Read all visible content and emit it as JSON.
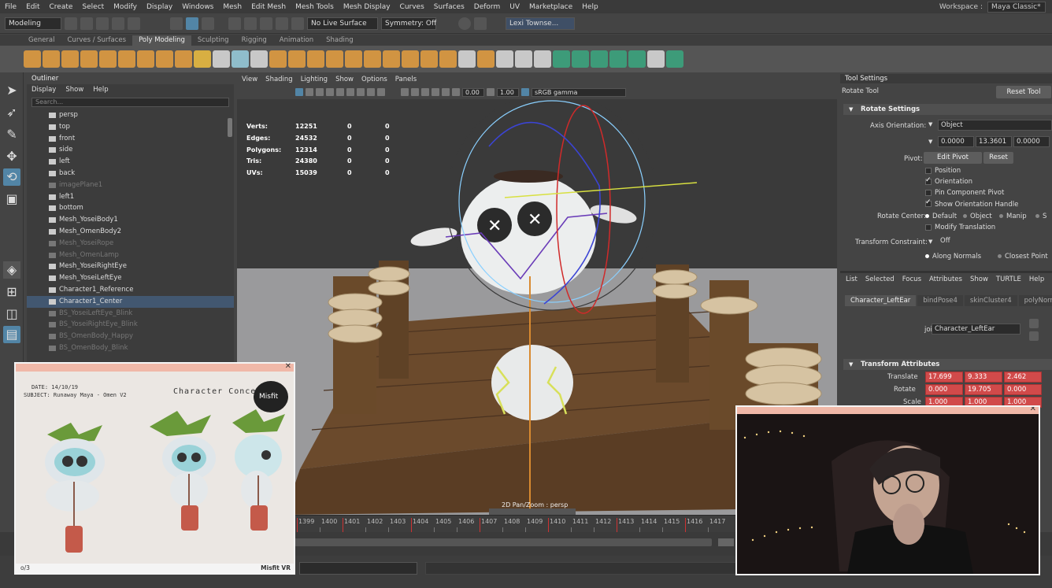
{
  "menubar": {
    "items": [
      "File",
      "Edit",
      "Create",
      "Select",
      "Modify",
      "Display",
      "Windows",
      "Mesh",
      "Edit Mesh",
      "Mesh Tools",
      "Mesh Display",
      "Curves",
      "Surfaces",
      "Deform",
      "UV",
      "Marketplace",
      "Help"
    ],
    "workspace_label": "Workspace :",
    "workspace_value": "Maya Classic*"
  },
  "status_line": {
    "mode": "Modeling",
    "live_surface": "No Live Surface",
    "symmetry": "Symmetry: Off",
    "user": "Lexi Townse..."
  },
  "shelf": {
    "tabs": [
      "General",
      "Curves / Surfaces",
      "Poly Modeling",
      "Sculpting",
      "Rigging",
      "Animation",
      "Shading"
    ],
    "active_tab": "Poly Modeling"
  },
  "outliner": {
    "title": "Outliner",
    "menu": [
      "Display",
      "Show",
      "Help"
    ],
    "search_placeholder": "Search...",
    "items": [
      {
        "label": "persp",
        "dim": false
      },
      {
        "label": "top",
        "dim": false
      },
      {
        "label": "front",
        "dim": false
      },
      {
        "label": "side",
        "dim": false
      },
      {
        "label": "left",
        "dim": false
      },
      {
        "label": "back",
        "dim": false
      },
      {
        "label": "imagePlane1",
        "dim": true
      },
      {
        "label": "left1",
        "dim": false
      },
      {
        "label": "bottom",
        "dim": false
      },
      {
        "label": "Mesh_YoseiBody1",
        "dim": false
      },
      {
        "label": "Mesh_OmenBody2",
        "dim": false
      },
      {
        "label": "Mesh_YoseiRope",
        "dim": true
      },
      {
        "label": "Mesh_OmenLamp",
        "dim": true
      },
      {
        "label": "Mesh_YoseiRightEye",
        "dim": false
      },
      {
        "label": "Mesh_YoseiLeftEye",
        "dim": false
      },
      {
        "label": "Character1_Reference",
        "dim": false
      },
      {
        "label": "Character1_Center",
        "dim": false,
        "selected": true
      },
      {
        "label": "BS_YoseiLeftEye_Blink",
        "dim": true
      },
      {
        "label": "BS_YoseiRightEye_Blink",
        "dim": true
      },
      {
        "label": "BS_OmenBody_Happy",
        "dim": true
      },
      {
        "label": "BS_OmenBody_Blink",
        "dim": true
      }
    ]
  },
  "viewport": {
    "menu": [
      "View",
      "Shading",
      "Lighting",
      "Show",
      "Options",
      "Panels"
    ],
    "exposure": "0.00",
    "gamma": "1.00",
    "color_space": "sRGB gamma",
    "hud": [
      {
        "label": "Verts:",
        "value": "12251",
        "a": "0",
        "b": "0"
      },
      {
        "label": "Edges:",
        "value": "24532",
        "a": "0",
        "b": "0"
      },
      {
        "label": "Polygons:",
        "value": "12314",
        "a": "0",
        "b": "0"
      },
      {
        "label": "Tris:",
        "value": "24380",
        "a": "0",
        "b": "0"
      },
      {
        "label": "UVs:",
        "value": "15039",
        "a": "0",
        "b": "0"
      }
    ],
    "camera_label": "2D Pan/Zoom : persp"
  },
  "tool_settings": {
    "title": "Tool Settings",
    "tool_name": "Rotate Tool",
    "reset_button": "Reset Tool",
    "section": "Rotate Settings",
    "axis_orientation_label": "Axis Orientation:",
    "axis_orientation_value": "Object",
    "axis_values": [
      "0.0000",
      "13.3601",
      "0.0000"
    ],
    "pivot_label": "Pivot:",
    "edit_pivot": "Edit Pivot",
    "reset": "Reset",
    "options": [
      {
        "label": "Position",
        "checked": false
      },
      {
        "label": "Orientation",
        "checked": true
      },
      {
        "label": "Pin Component Pivot",
        "checked": false
      },
      {
        "label": "Show Orientation Handle",
        "checked": true
      }
    ],
    "rotate_center_label": "Rotate Center:",
    "rotate_center_options": [
      {
        "label": "Default",
        "selected": true
      },
      {
        "label": "Object",
        "selected": false
      },
      {
        "label": "Manip",
        "selected": false
      },
      {
        "label": "S",
        "selected": false
      }
    ],
    "modify_translation": "Modify Translation",
    "transform_constraint_label": "Transform Constraint:",
    "transform_constraint_value": "Off",
    "along_normals": "Along Normals",
    "closest_point": "Closest Point"
  },
  "attribute_editor": {
    "menu": [
      "List",
      "Selected",
      "Focus",
      "Attributes",
      "Show",
      "TURTLE",
      "Help"
    ],
    "tabs": [
      "Character_LeftEar",
      "bindPose4",
      "skinCluster4",
      "polyNormal1"
    ],
    "joint_label": "joint:",
    "joint_value": "Character_LeftEar",
    "section": "Transform Attributes",
    "rows": [
      {
        "label": "Translate",
        "values": [
          "17.699",
          "9.333",
          "2.462"
        ]
      },
      {
        "label": "Rotate",
        "values": [
          "0.000",
          "19.705",
          "0.000"
        ]
      },
      {
        "label": "Scale",
        "values": [
          "1.000",
          "1.000",
          "1.000"
        ]
      }
    ]
  },
  "timeline": {
    "frames": [
      "1399",
      "1400",
      "1401",
      "1402",
      "1403",
      "1404",
      "1405",
      "1406",
      "1407",
      "1408",
      "1409",
      "1410",
      "1411",
      "1412",
      "1413",
      "1414",
      "1415",
      "1416",
      "1417"
    ]
  },
  "concept_popup": {
    "title": "Character Concept",
    "date_line": "DATE: 14/10/19",
    "subject_line": "SUBJECT: Runaway Maya - Omen V2",
    "footer_left": "o/3",
    "footer_right": "Misfit VR",
    "badge": "Misfit"
  },
  "colors": {
    "accent_blue": "#5285a6",
    "keyframe_red": "#cc3333",
    "attr_red": "#d14a4a",
    "popup_bar": "#f0b8a8"
  }
}
